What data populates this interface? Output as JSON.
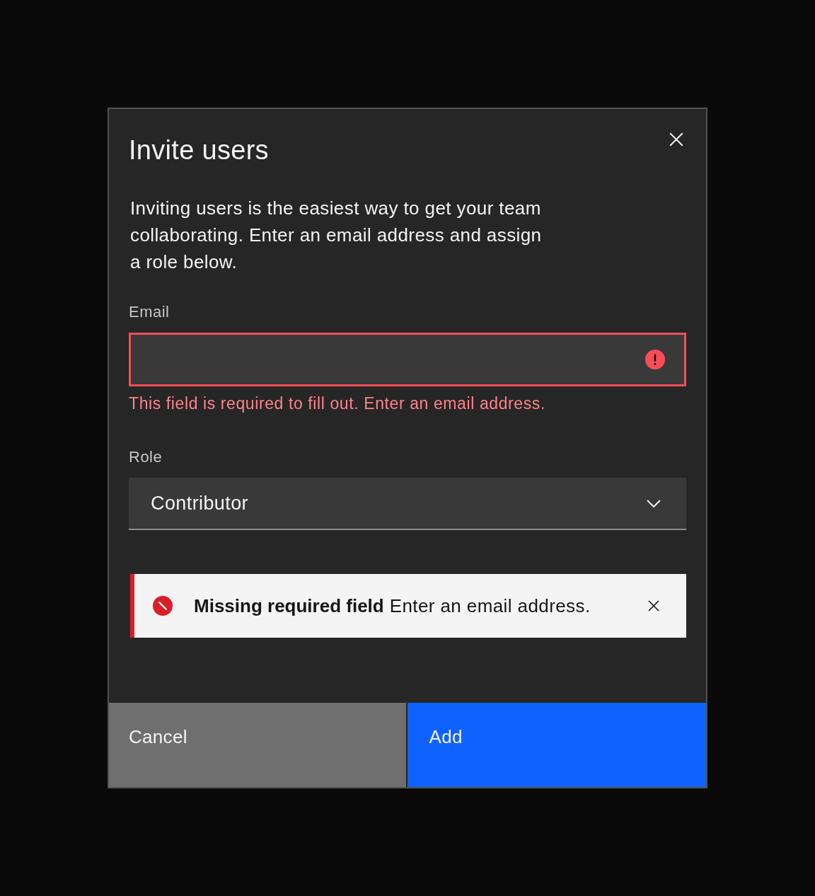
{
  "modal": {
    "title": "Invite users",
    "description": "Inviting users is the easiest way to get your team collaborating. Enter an email address and assign a role below."
  },
  "fields": [
    {
      "kind": "text",
      "label": "Email",
      "invalid": true,
      "error": "This field is required to fill out. Enter an email address."
    },
    {
      "kind": "select",
      "label": "Role",
      "value": "Contributor"
    }
  ],
  "notification": {
    "kind": "error",
    "title": "Missing required field",
    "subtitle": "Enter an email address."
  },
  "buttons": [
    {
      "kind": "secondary",
      "label": "Cancel"
    },
    {
      "kind": "primary",
      "label": "Add"
    }
  ]
}
